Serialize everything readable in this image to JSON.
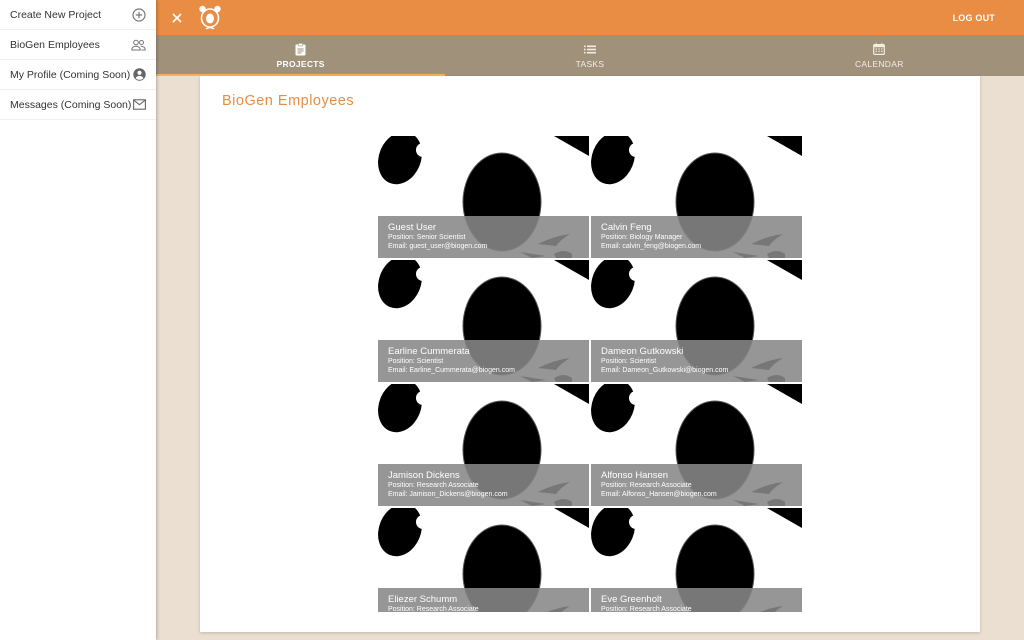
{
  "sidebar": {
    "items": [
      {
        "label": "Create New Project",
        "icon": "plus-circle-icon"
      },
      {
        "label": "BioGen Employees",
        "icon": "people-icon"
      },
      {
        "label": "My Profile (Coming Soon)",
        "icon": "account-circle-icon"
      },
      {
        "label": "Messages (Coming Soon)",
        "icon": "mail-icon"
      }
    ]
  },
  "topbar": {
    "close_icon": "close-icon",
    "logo_icon": "panda-logo-icon",
    "logout_label": "LOG OUT",
    "color": "#e88d43"
  },
  "tabs": [
    {
      "label": "PROJECTS",
      "icon": "clipboard-icon",
      "active": true
    },
    {
      "label": "TASKS",
      "icon": "list-icon",
      "active": false
    },
    {
      "label": "CALENDAR",
      "icon": "calendar-icon",
      "active": false
    }
  ],
  "page": {
    "title": "BioGen Employees",
    "accent": "#e88d43",
    "background": "#eadfd0"
  },
  "employees": [
    {
      "name": "Guest User",
      "position": "Position: Senior Scientist",
      "email": "Email: guest_user@biogen.com"
    },
    {
      "name": "Calvin Feng",
      "position": "Position: Biology Manager",
      "email": "Email: calvin_feng@biogen.com"
    },
    {
      "name": "Earline Cummerata",
      "position": "Position: Scientist",
      "email": "Email: Earline_Cummerata@biogen.com"
    },
    {
      "name": "Dameon Gutkowski",
      "position": "Position: Scientist",
      "email": "Email: Dameon_Gutkowski@biogen.com"
    },
    {
      "name": "Jamison Dickens",
      "position": "Position: Research Associate",
      "email": "Email: Jamison_Dickens@biogen.com"
    },
    {
      "name": "Alfonso Hansen",
      "position": "Position: Research Associate",
      "email": "Email: Alfonso_Hansen@biogen.com"
    },
    {
      "name": "Eliezer Schumm",
      "position": "Position: Research Associate",
      "email": ""
    },
    {
      "name": "Eve Greenholt",
      "position": "Position: Research Associate",
      "email": ""
    }
  ]
}
